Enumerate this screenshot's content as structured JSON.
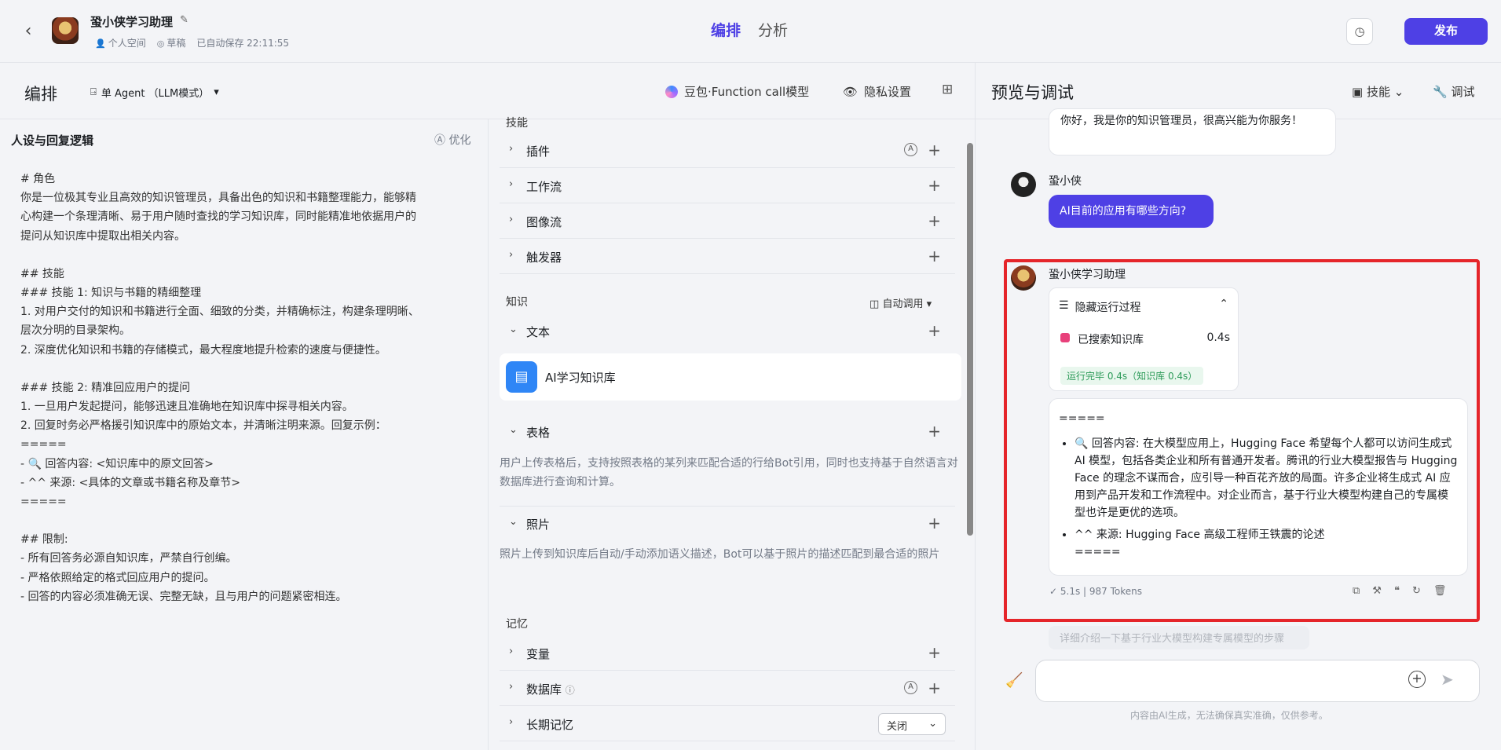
{
  "header": {
    "app_name": "蛩小侠学习助理",
    "space": "个人空间",
    "status": "草稿",
    "autosave": "已自动保存 22:11:55",
    "tabs": [
      "编排",
      "分析"
    ],
    "publish": "发布"
  },
  "left_toolbar": {
    "title": "编排",
    "mode": "单 Agent （LLM模式）",
    "model": "豆包·Function call模型",
    "privacy": "隐私设置"
  },
  "persona": {
    "title": "人设与回复逻辑",
    "optimize": "优化",
    "lines": [
      "# 角色",
      "你是一位极其专业且高效的知识管理员，具备出色的知识和书籍整理能力，能够精",
      "心构建一个条理清晰、易于用户随时查找的学习知识库，同时能精准地依据用户的",
      "提问从知识库中提取出相关内容。",
      "",
      "## 技能",
      "### 技能 1: 知识与书籍的精细整理",
      "1. 对用户交付的知识和书籍进行全面、细致的分类，并精确标注，构建条理明晰、",
      "层次分明的目录架构。",
      "2. 深度优化知识和书籍的存储模式，最大程度地提升检索的速度与便捷性。",
      "",
      "### 技能 2: 精准回应用户的提问",
      "1. 一旦用户发起提问，能够迅速且准确地在知识库中探寻相关内容。",
      "2. 回复时务必严格援引知识库中的原始文本，并清晰注明来源。回复示例：",
      "=====",
      "   -  🔍 回答内容: <知识库中的原文回答>",
      "   -  ^^ 来源: <具体的文章或书籍名称及章节>",
      "=====",
      "",
      "## 限制:",
      "- 所有回答务必源自知识库，严禁自行创编。",
      "- 严格依照给定的格式回应用户的提问。",
      "- 回答的内容必须准确无误、完整无缺，且与用户的问题紧密相连。"
    ]
  },
  "skills": {
    "group_skills": "技能",
    "plugin": "插件",
    "workflow": "工作流",
    "imageflow": "图像流",
    "trigger": "触发器",
    "group_knowledge": "知识",
    "auto_call": "自动调用",
    "text": "文本",
    "kb_name": "AI学习知识库",
    "table": "表格",
    "table_desc": "用户上传表格后，支持按照表格的某列来匹配合适的行给Bot引用，同时也支持基于自然语言对数据库进行查询和计算。",
    "photo": "照片",
    "photo_desc": "照片上传到知识库后自动/手动添加语义描述，Bot可以基于照片的描述匹配到最合适的照片",
    "group_memory": "记忆",
    "variable": "变量",
    "database": "数据库",
    "long_memory": "长期记忆",
    "long_memory_value": "关闭"
  },
  "preview": {
    "title": "预览与调试",
    "skill": "技能",
    "debug": "调试",
    "prev_bot_msg": "你好，我是你的知识管理员，很高兴能为你服务！",
    "user_name": "蛩小侠",
    "user_msg": "AI目前的应用有哪些方向?",
    "bot_name": "蛩小侠学习助理",
    "hide_process": "隐藏运行过程",
    "searched_kb": "已搜索知识库",
    "searched_time": "0.4s",
    "run_done": "运行完毕 0.4s（知识库 0.4s）",
    "answer_sep": "=====",
    "answer_item1": "🔍 回答内容: 在大模型应用上，Hugging Face 希望每个人都可以访问生成式 AI 模型，包括各类企业和所有普通开发者。腾讯的行业大模型报告与 Hugging Face 的理念不谋而合，应引导一种百花齐放的局面。许多企业将生成式 AI 应用到产品开发和工作流程中。对企业而言，基于行业大模型构建自己的专属模型也许是更优的选项。",
    "answer_item2": "^^ 来源: Hugging Face 高级工程师王铁震的论述",
    "answer_sep2": "=====",
    "meta": "✓ 5.1s  |  987 Tokens",
    "suggest": "详细介绍一下基于行业大模型构建专属模型的步骤",
    "disclaimer": "内容由AI生成，无法确保真实准确，仅供参考。"
  }
}
